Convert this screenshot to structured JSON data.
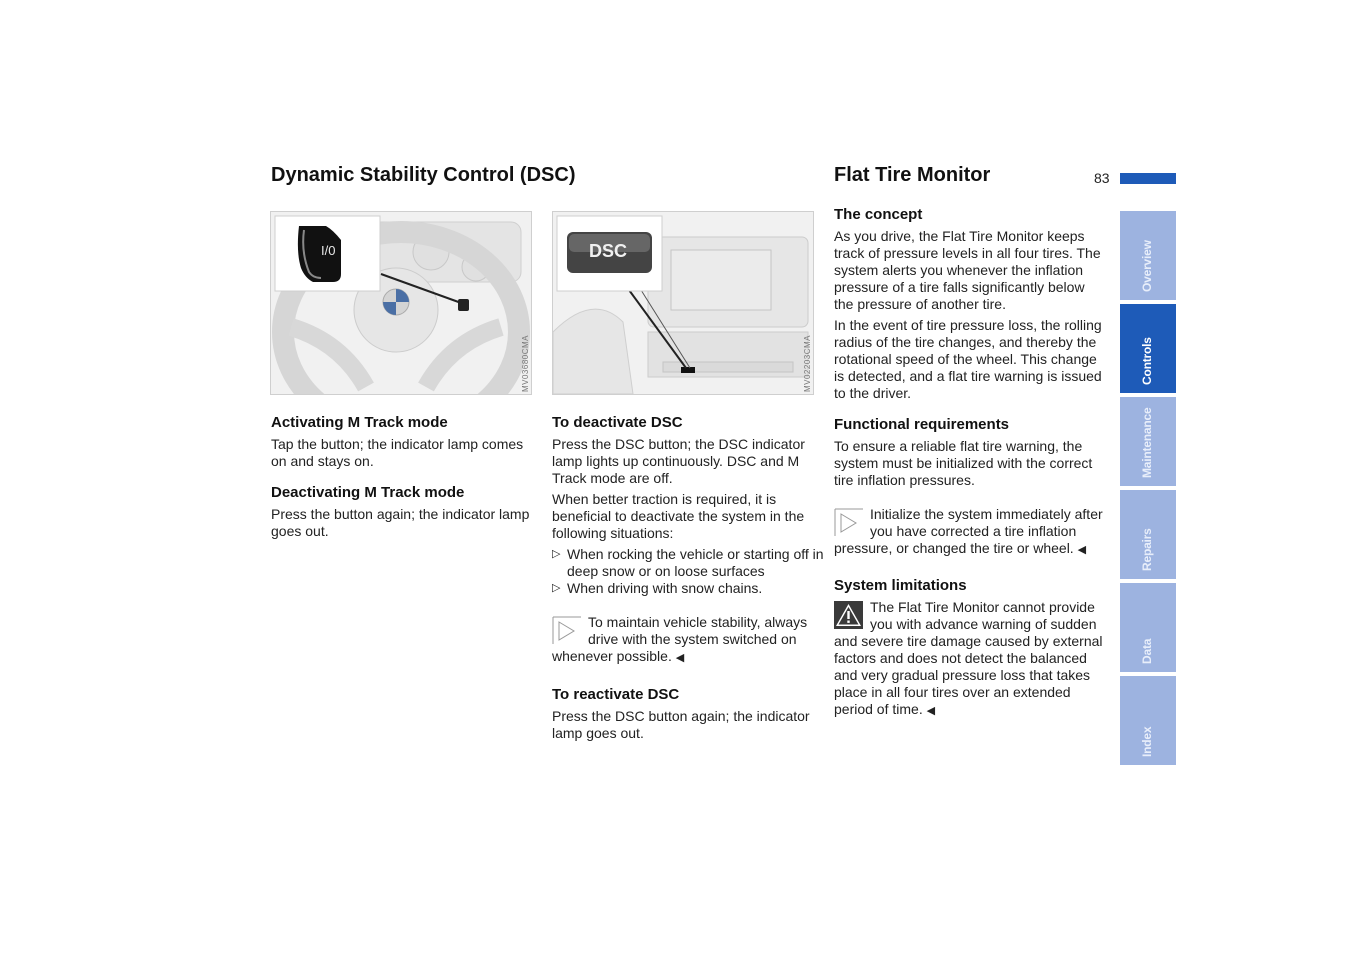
{
  "page": {
    "number": "83",
    "accent_color": "#1e5bb8",
    "tab_color": "#9db3e0"
  },
  "left": {
    "title": "Dynamic Stability Control (DSC)",
    "figure1": {
      "label": "I/0",
      "code": "MV03680CMA"
    },
    "figure2": {
      "label": "DSC",
      "code": "MV02203CMA"
    },
    "col1": {
      "sections": [
        {
          "heading": "Activating M Track mode",
          "text": "Tap the button; the indicator lamp comes on and stays on."
        },
        {
          "heading": "Deactivating M Track mode",
          "text": "Press the button again; the indicator lamp goes out."
        }
      ]
    },
    "col2": {
      "deactivate_heading": "To deactivate DSC",
      "deactivate_p1": "Press the DSC button; the DSC indicator lamp lights up continuously. DSC and M Track mode are off.",
      "deactivate_p2": "When better traction is required, it is beneficial to deactivate the system in the following situations:",
      "bullets": [
        "When rocking the vehicle or starting off in deep snow or on loose surfaces",
        "When driving with snow chains."
      ],
      "note": "To maintain vehicle stability, always drive with the system switched on whenever possible.",
      "reactivate_heading": "To reactivate DSC",
      "reactivate_text": "Press the DSC button again; the indicator lamp goes out."
    }
  },
  "right": {
    "title": "Flat Tire Monitor",
    "concept_heading": "The concept",
    "concept_p1": "As you drive, the Flat Tire Monitor keeps track of pressure levels in all four tires. The system alerts you whenever the inflation pressure of a tire falls significantly below the pressure of another tire.",
    "concept_p2": "In the event of tire pressure loss, the rolling radius of the tire changes, and thereby the rotational speed of the wheel. This change is detected, and a flat tire warning is issued to the driver.",
    "req_heading": "Functional requirements",
    "req_text": "To ensure a reliable flat tire warning, the system must be initialized with the correct tire inflation pressures.",
    "req_note": "Initialize the system immediately after you have corrected a tire inflation pressure, or changed the tire or wheel.",
    "limits_heading": "System limitations",
    "limits_warning": "The Flat Tire Monitor cannot provide you with advance warning of sudden and severe tire damage caused by external factors and does not detect the balanced and very gradual pressure loss that takes place in all four tires over an extended period of time."
  },
  "tabs": [
    {
      "label": "Overview",
      "active": false
    },
    {
      "label": "Controls",
      "active": true
    },
    {
      "label": "Maintenance",
      "active": false
    },
    {
      "label": "Repairs",
      "active": false
    },
    {
      "label": "Data",
      "active": false
    },
    {
      "label": "Index",
      "active": false
    }
  ],
  "symbols": {
    "bullet": "▷",
    "end": "◀"
  }
}
